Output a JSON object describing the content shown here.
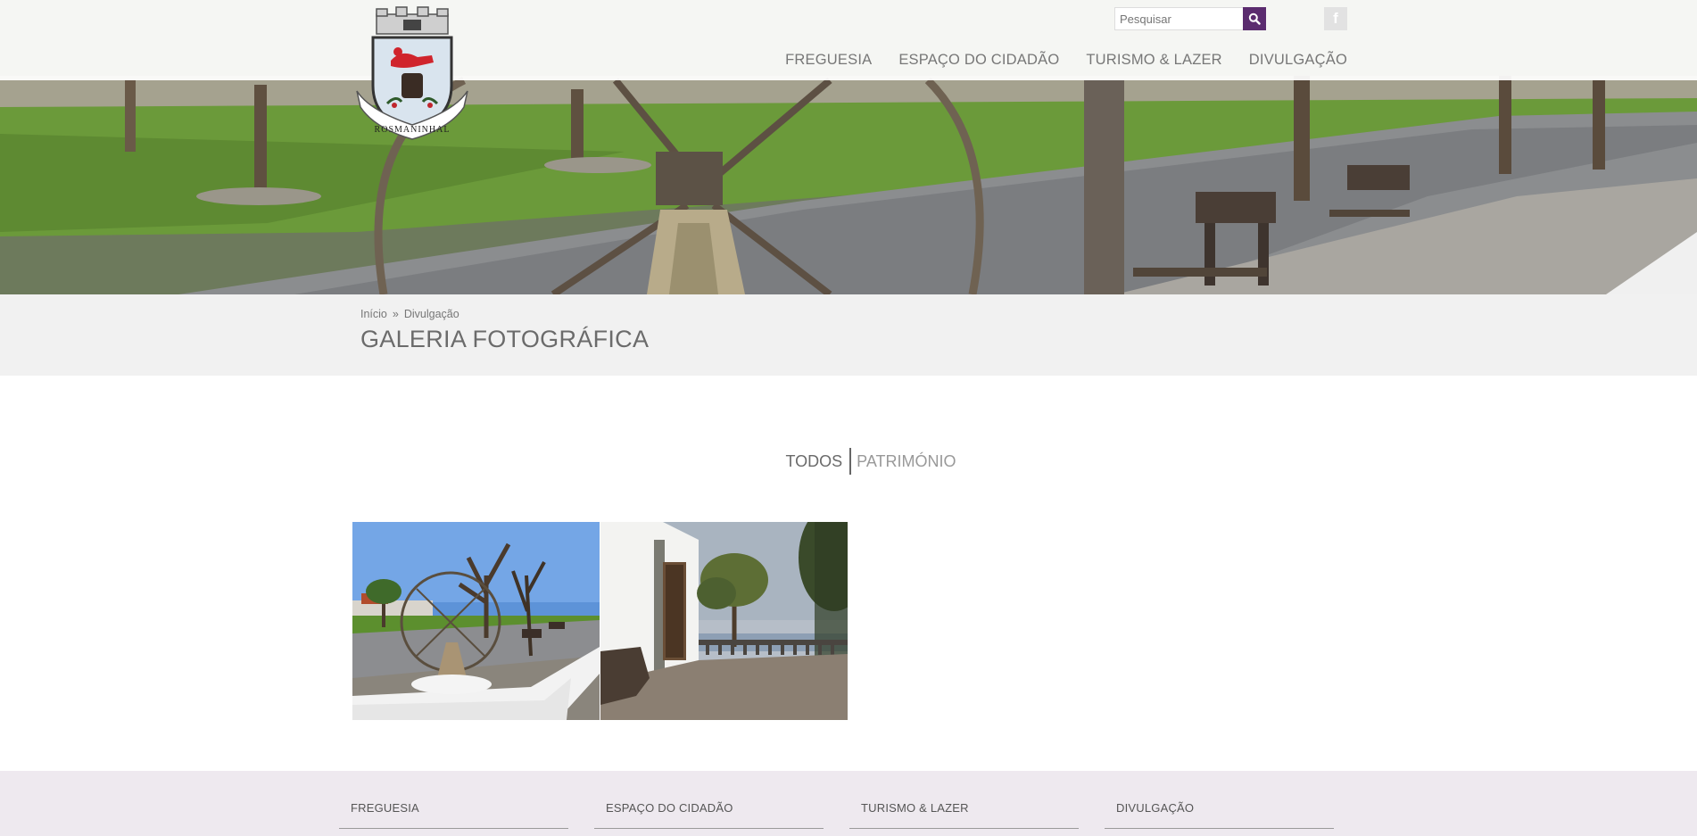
{
  "header": {
    "logo_text": "ROSMANINHAL",
    "search": {
      "placeholder": "Pesquisar"
    },
    "social": {
      "facebook_label": "f"
    },
    "nav": [
      {
        "label": "FREGUESIA"
      },
      {
        "label": "ESPAÇO DO CIDADÃO"
      },
      {
        "label": "TURISMO & LAZER"
      },
      {
        "label": "DIVULGAÇÃO"
      }
    ]
  },
  "breadcrumb": {
    "home": "Início",
    "separator": "»",
    "current": "Divulgação"
  },
  "page_title": "GALERIA FOTOGRÁFICA",
  "filters": {
    "all": "TODOS",
    "heritage": "PATRIMÓNIO"
  },
  "gallery": {
    "items": [
      {
        "icon": "photo-wheel-monument"
      },
      {
        "icon": "photo-church-viewpoint"
      }
    ]
  },
  "footer": {
    "columns": [
      {
        "label": "FREGUESIA"
      },
      {
        "label": "ESPAÇO DO CIDADÃO"
      },
      {
        "label": "TURISMO & LAZER"
      },
      {
        "label": "DIVULGAÇÃO"
      }
    ]
  },
  "colors": {
    "accent": "#5b2c6f",
    "footer_bg": "#eee9ef",
    "title_band_bg": "#f1f1f1"
  }
}
